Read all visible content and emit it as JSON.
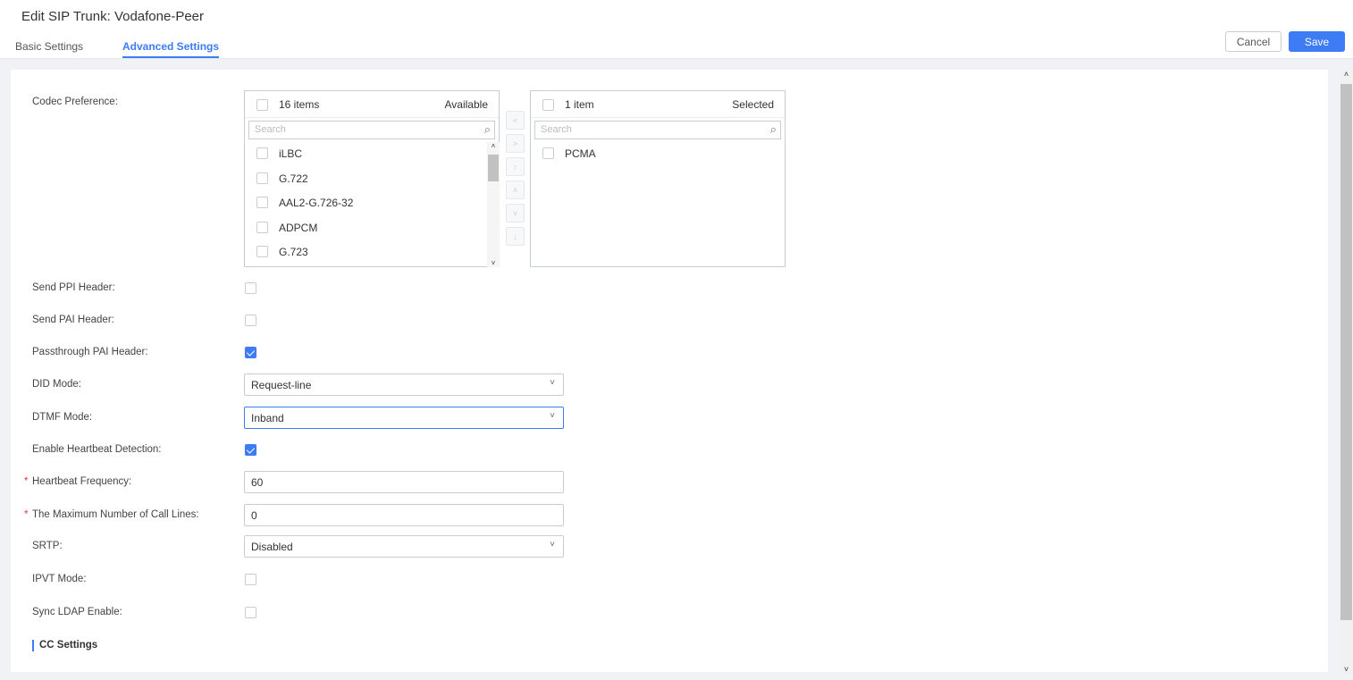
{
  "header": {
    "title": "Edit SIP Trunk: Vodafone-Peer",
    "tabs": [
      "Basic Settings",
      "Advanced Settings"
    ],
    "cancel": "Cancel",
    "save": "Save"
  },
  "codec": {
    "label": "Codec Preference:",
    "available": {
      "count": "16 items",
      "title": "Available",
      "search_placeholder": "Search",
      "items": [
        "iLBC",
        "G.722",
        "AAL2-G.726-32",
        "ADPCM",
        "G.723"
      ]
    },
    "selected": {
      "count": "1 item",
      "title": "Selected",
      "search_placeholder": "Search",
      "items": [
        "PCMA"
      ]
    }
  },
  "fields": {
    "send_ppi": {
      "label": "Send PPI Header:",
      "checked": false
    },
    "send_pai": {
      "label": "Send PAI Header:",
      "checked": false
    },
    "passthrough_pai": {
      "label": "Passthrough PAI Header:",
      "checked": true
    },
    "did_mode": {
      "label": "DID Mode:",
      "value": "Request-line"
    },
    "dtmf_mode": {
      "label": "DTMF Mode:",
      "value": "Inband"
    },
    "heartbeat": {
      "label": "Enable Heartbeat Detection:",
      "checked": true
    },
    "heartbeat_freq": {
      "label": "Heartbeat Frequency:",
      "value": "60"
    },
    "max_lines": {
      "label": "The Maximum Number of Call Lines:",
      "value": "0"
    },
    "srtp": {
      "label": "SRTP:",
      "value": "Disabled"
    },
    "ipvt": {
      "label": "IPVT Mode:",
      "checked": false
    },
    "sync_ldap": {
      "label": "Sync LDAP Enable:",
      "checked": false
    }
  },
  "section": {
    "cc_settings": "CC Settings"
  },
  "required_mark": "*"
}
